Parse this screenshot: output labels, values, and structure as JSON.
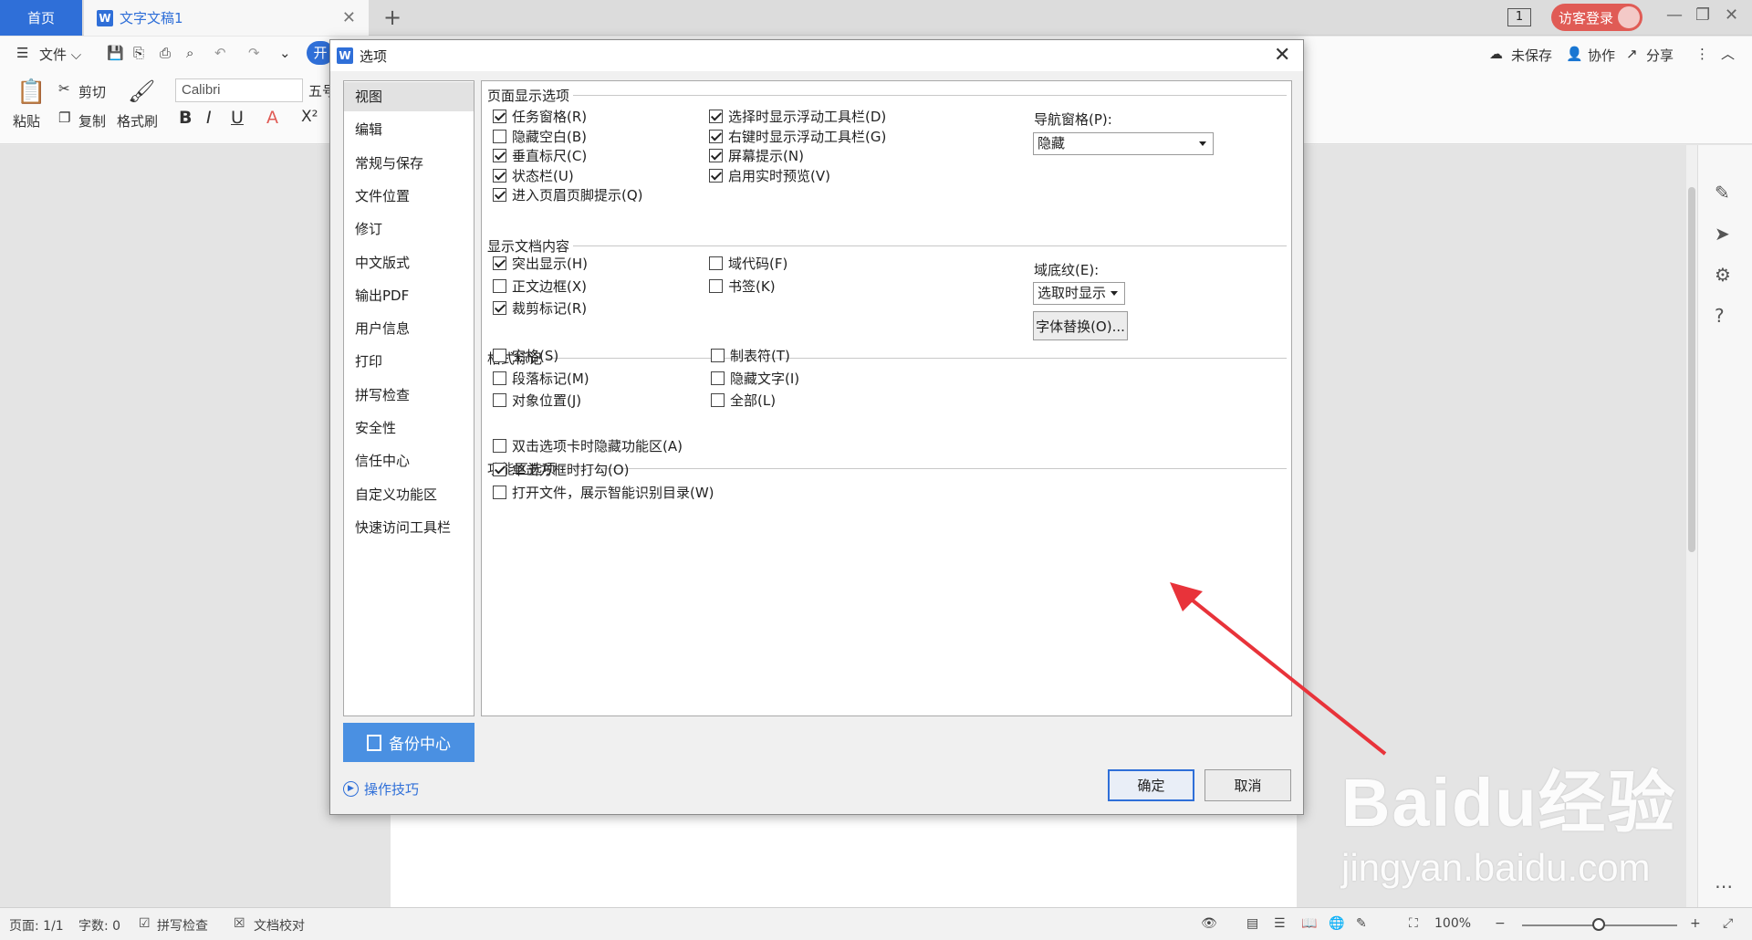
{
  "tabs": {
    "home": "首页",
    "doc": "文字文稿1",
    "new": "+"
  },
  "titlebar": {
    "page_indicator": "1",
    "login": "访客登录"
  },
  "menu": {
    "file": "文件",
    "start_partial": "开"
  },
  "toolbar": {
    "paste": "粘贴",
    "cut": "剪切",
    "copy": "复制",
    "format_painter": "格式刷",
    "font": "Calibri",
    "size_partial": "五号",
    "bold": "B",
    "italic": "I",
    "underline": "U",
    "font_color": "A",
    "clear": "X²"
  },
  "right_actions": {
    "unsaved": "未保存",
    "collab": "协作",
    "share": "分享"
  },
  "dialog": {
    "title": "选项",
    "nav": [
      "视图",
      "编辑",
      "常规与保存",
      "文件位置",
      "修订",
      "中文版式",
      "输出PDF",
      "用户信息",
      "打印",
      "拼写检查",
      "安全性",
      "信任中心",
      "自定义功能区",
      "快速访问工具栏"
    ],
    "nav_selected": 0,
    "backup": "备份中心",
    "tips": "操作技巧",
    "ok": "确定",
    "cancel": "取消",
    "sections": {
      "page_display": "页面显示选项",
      "doc_content": "显示文档内容",
      "format_marks": "格式标记",
      "ribbon": "功能区选项"
    },
    "page_display": {
      "col1": [
        {
          "label": "任务窗格(R)",
          "checked": true
        },
        {
          "label": "隐藏空白(B)",
          "checked": false
        },
        {
          "label": "垂直标尺(C)",
          "checked": true
        },
        {
          "label": "状态栏(U)",
          "checked": true
        },
        {
          "label": "进入页眉页脚提示(Q)",
          "checked": true
        }
      ],
      "col2": [
        {
          "label": "选择时显示浮动工具栏(D)",
          "checked": true
        },
        {
          "label": "右键时显示浮动工具栏(G)",
          "checked": true
        },
        {
          "label": "屏幕提示(N)",
          "checked": true
        },
        {
          "label": "启用实时预览(V)",
          "checked": true
        }
      ],
      "nav_pane_label": "导航窗格(P):",
      "nav_pane_value": "隐藏"
    },
    "doc_content": {
      "col1": [
        {
          "label": "突出显示(H)",
          "checked": true
        },
        {
          "label": "正文边框(X)",
          "checked": false
        },
        {
          "label": "裁剪标记(R)",
          "checked": true
        }
      ],
      "col2": [
        {
          "label": "域代码(F)",
          "checked": false
        },
        {
          "label": "书签(K)",
          "checked": false
        }
      ],
      "field_shading_label": "域底纹(E):",
      "field_shading_value": "选取时显示",
      "font_sub_button": "字体替换(O)..."
    },
    "format_marks": {
      "col1": [
        {
          "label": "空格(S)",
          "checked": false
        },
        {
          "label": "段落标记(M)",
          "checked": false
        },
        {
          "label": "对象位置(J)",
          "checked": false
        }
      ],
      "col2": [
        {
          "label": "制表符(T)",
          "checked": false
        },
        {
          "label": "隐藏文字(I)",
          "checked": false
        },
        {
          "label": "全部(L)",
          "checked": false
        }
      ]
    },
    "ribbon": [
      {
        "label": "双击选项卡时隐藏功能区(A)",
        "checked": false
      },
      {
        "label": "单击方框时打勾(O)",
        "checked": true
      },
      {
        "label": "打开文件，展示智能识别目录(W)",
        "checked": false
      }
    ]
  },
  "statusbar": {
    "page": "页面: 1/1",
    "words": "字数: 0",
    "spell": "拼写检查",
    "proof": "文档校对",
    "zoom": "100%"
  },
  "watermark": {
    "brand": "Baidu经验",
    "url": "jingyan.baidu.com"
  },
  "colors": {
    "accent": "#2f6fd8",
    "login": "#e05b55",
    "arrow": "#e8333a",
    "backup": "#4a90e2"
  }
}
